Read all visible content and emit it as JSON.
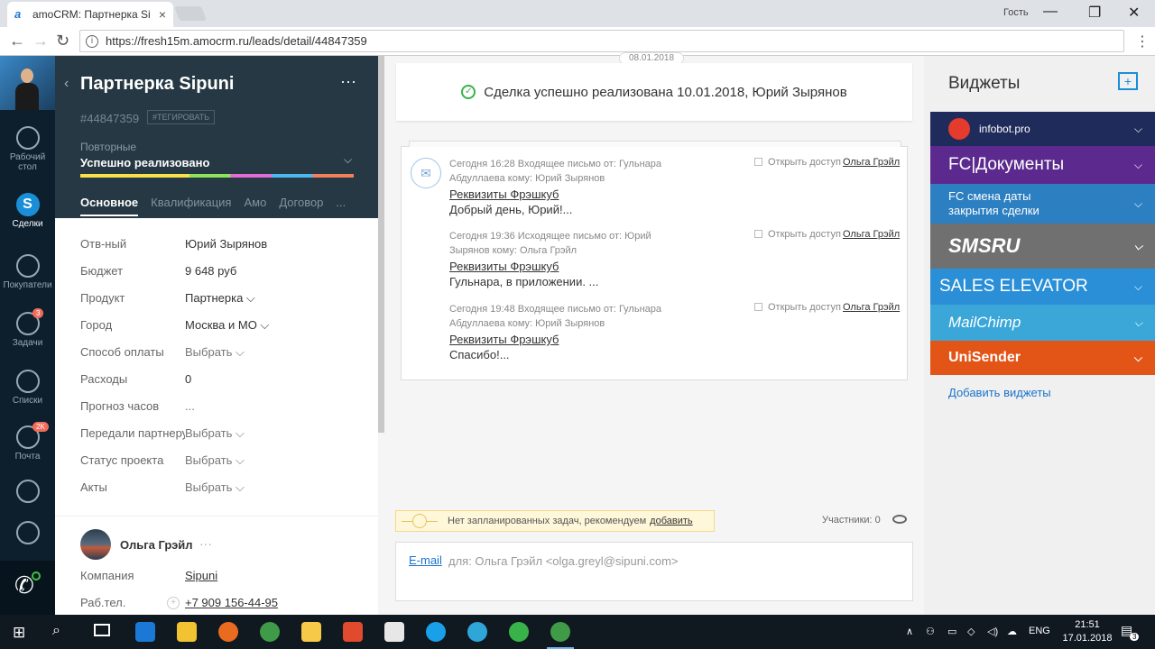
{
  "browser": {
    "tab_title": "amoCRM: Партнерка Sip",
    "tab_close": "×",
    "guest": "Гость",
    "url": "https://fresh15m.amocrm.ru/leads/detail/44847359",
    "favicon": "a"
  },
  "sidebar": {
    "items": [
      {
        "label": "Рабочий стол"
      },
      {
        "label": "Сделки"
      },
      {
        "label": "Покупатели"
      },
      {
        "label": "Задачи",
        "badge": "3"
      },
      {
        "label": "Списки"
      },
      {
        "label": "Почта",
        "badge": "2K"
      }
    ]
  },
  "deal": {
    "title": "Партнерка Sipuni",
    "id": "#44847359",
    "tag_button": "#ТЕГИРОВАТЬ",
    "stage_caption": "Повторные",
    "stage_value": "Успешно реализовано",
    "tabs": [
      "Основное",
      "Квалификация",
      "Амо",
      "Договор",
      "..."
    ],
    "fields": [
      {
        "label": "Отв-ный",
        "value": "Юрий Зырянов",
        "muted": false
      },
      {
        "label": "Бюджет",
        "value": "9 648 руб",
        "muted": false
      },
      {
        "label": "Продукт",
        "value": "Партнерка ⌵",
        "muted": false
      },
      {
        "label": "Город",
        "value": "Москва и МО ⌵",
        "muted": false
      },
      {
        "label": "Способ оплаты",
        "value": "Выбрать ⌵",
        "muted": true
      },
      {
        "label": "Расходы",
        "value": "0",
        "muted": false
      },
      {
        "label": "Прогноз часов",
        "value": "...",
        "muted": true
      },
      {
        "label": "Передали партнеру",
        "value": "Выбрать ⌵",
        "muted": true
      },
      {
        "label": "Статус проекта",
        "value": "Выбрать ⌵",
        "muted": true
      },
      {
        "label": "Акты",
        "value": "Выбрать ⌵",
        "muted": true
      }
    ]
  },
  "contact": {
    "name": "Ольга Грэйл",
    "dots": "···",
    "company_label": "Компания",
    "company": "Sipuni",
    "phone_label": "Раб.тел.",
    "phone": "+7 909 156-44-95"
  },
  "feed": {
    "date_pill": "08.01.2018",
    "success": "Сделка успешно реализована 10.01.2018, Юрий Зырянов",
    "messages": [
      {
        "meta": "Сегодня 16:28 Входящее письмо от: Гульнара Абдуллаева кому: Юрий Зырянов",
        "access": "Открыть доступ",
        "who": "Ольга Грэйл",
        "subject": "Реквизиты Фрэшкуб",
        "body": "Добрый день, Юрий!..."
      },
      {
        "meta": "Сегодня 19:36 Исходящее письмо от: Юрий Зырянов кому: Ольга Грэйл",
        "access": "Открыть доступ",
        "who": "Ольга Грэйл",
        "subject": "Реквизиты Фрэшкуб",
        "body": "Гульнара, в приложении. ..."
      },
      {
        "meta": "Сегодня 19:48 Входящее письмо от: Гульнара Абдуллаева кому: Юрий Зырянов",
        "access": "Открыть доступ",
        "who": "Ольга Грэйл",
        "subject": "Реквизиты Фрэшкуб",
        "body": "Спасибо!..."
      }
    ],
    "notask_text": "Нет запланированных задач, рекомендуем",
    "notask_link": "добавить",
    "participants": "Участники: 0",
    "compose_type": "E-mail",
    "compose_to": "для: Ольга Грэйл <olga.greyl@sipuni.com>"
  },
  "widgets": {
    "title": "Виджеты",
    "add_label": "Добавить виджеты",
    "items": [
      {
        "label": "infobot.pro",
        "color": "#1f2b5b"
      },
      {
        "label": "FC|Документы",
        "color": "#5c2a8f"
      },
      {
        "label": "FC смена даты закрытия сделки",
        "color": "#2c7fc0"
      },
      {
        "label": "SMSRU",
        "color": "#707070"
      },
      {
        "label": "SALES ELEVATOR",
        "color": "#2a8fd6"
      },
      {
        "label": "MailChimp",
        "color": "#3aa7d8"
      },
      {
        "label": "UniSender",
        "color": "#e35417"
      }
    ]
  },
  "taskbar": {
    "lang": "ENG",
    "time": "21:51",
    "date": "17.01.2018",
    "notif": "3"
  }
}
